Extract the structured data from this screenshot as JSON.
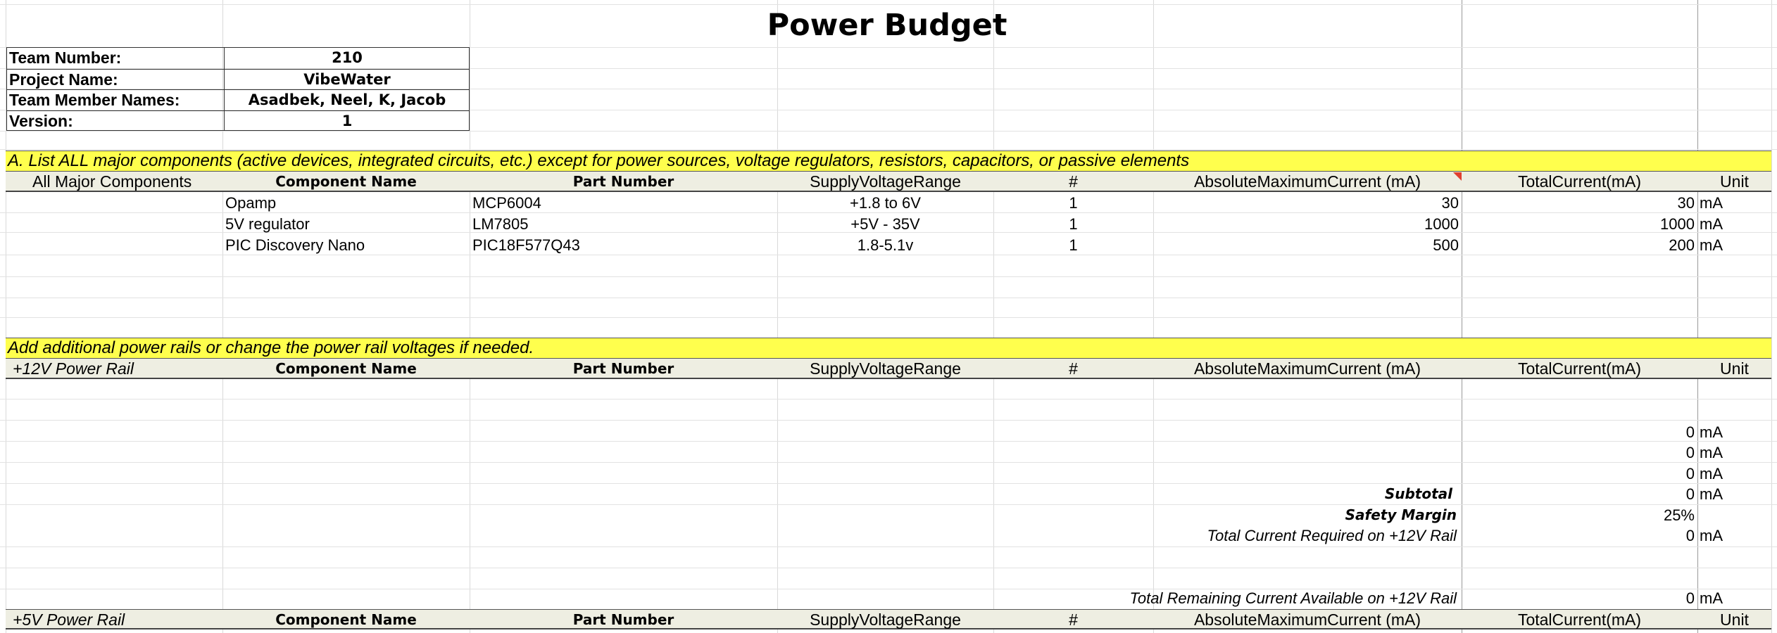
{
  "title": "Power Budget",
  "info": [
    {
      "label": "Team Number:",
      "value": "210"
    },
    {
      "label": "Project Name:",
      "value": "VibeWater"
    },
    {
      "label": "Team Member Names:",
      "value": "Asadbek, Neel, K, Jacob"
    },
    {
      "label": "Version:",
      "value": "1"
    }
  ],
  "section_a": {
    "banner": "A. List ALL major components (active devices, integrated circuits, etc.) except for power sources, voltage regulators, resistors, capacitors, or passive elements",
    "headers": {
      "group": "All Major Components",
      "component_name": "Component Name",
      "part_number": "Part Number",
      "supply_voltage": "SupplyVoltageRange",
      "count": "#",
      "abs_max_current": "AbsoluteMaximumCurrent (mA)",
      "total_current": "TotalCurrent(mA)",
      "unit": "Unit"
    },
    "rows": [
      {
        "name": "Opamp",
        "part": "MCP6004",
        "voltage": "+1.8 to 6V",
        "count": "1",
        "abs_max": "30",
        "total": "30",
        "unit": "mA"
      },
      {
        "name": "5V regulator",
        "part": "LM7805",
        "voltage": "+5V - 35V",
        "count": "1",
        "abs_max": "1000",
        "total": "1000",
        "unit": "mA"
      },
      {
        "name": "PIC Discovery Nano",
        "part": "PIC18F577Q43",
        "voltage": "1.8-5.1v",
        "count": "1",
        "abs_max": "500",
        "total": "200",
        "unit": "mA"
      }
    ]
  },
  "rails_banner": "Add additional power rails or change the power rail voltages if needed.",
  "rail_12v": {
    "headers": {
      "group": "+12V Power Rail",
      "component_name": "Component Name",
      "part_number": "Part Number",
      "supply_voltage": "SupplyVoltageRange",
      "count": "#",
      "abs_max_current": "AbsoluteMaximumCurrent (mA)",
      "total_current": "TotalCurrent(mA)",
      "unit": "Unit"
    },
    "rows": [
      {
        "total": "0",
        "unit": "mA"
      },
      {
        "total": "0",
        "unit": "mA"
      },
      {
        "total": "0",
        "unit": "mA"
      }
    ],
    "subtotal_label": "Subtotal",
    "subtotal_value": "0",
    "subtotal_unit": "mA",
    "safety_label": "Safety Margin",
    "safety_value": "25%",
    "total_required_label": "Total Current Required on +12V Rail",
    "total_required_value": "0",
    "total_required_unit": "mA",
    "remaining_label": "Total Remaining Current Available on +12V Rail",
    "remaining_value": "0",
    "remaining_unit": "mA"
  },
  "rail_5v": {
    "headers": {
      "group": "+5V Power Rail",
      "component_name": "Component Name",
      "part_number": "Part Number",
      "supply_voltage": "SupplyVoltageRange",
      "count": "#",
      "abs_max_current": "AbsoluteMaximumCurrent (mA)",
      "total_current": "TotalCurrent(mA)",
      "unit": "Unit"
    }
  }
}
